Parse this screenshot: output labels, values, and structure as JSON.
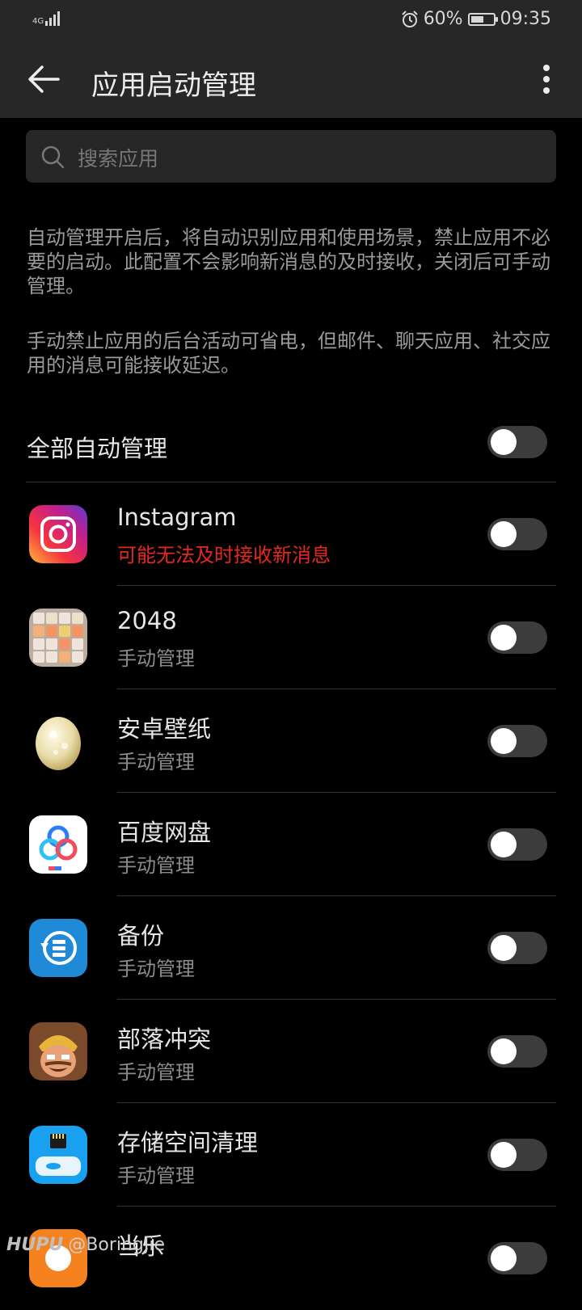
{
  "status_bar": {
    "network": "4G",
    "battery": "60%",
    "battery_level": 0.6,
    "time": "09:35"
  },
  "app_bar": {
    "title": "应用启动管理"
  },
  "search": {
    "placeholder": "搜索应用"
  },
  "descriptions": [
    "自动管理开启后，将自动识别应用和使用场景，禁止应用不必要的启动。此配置不会影响新消息的及时接收，关闭后可手动管理。",
    "手动禁止应用的后台活动可省电，但邮件、聊天应用、社交应用的消息可能接收延迟。"
  ],
  "all_auto": {
    "label": "全部自动管理",
    "enabled": false
  },
  "apps": [
    {
      "name": "Instagram",
      "status": "可能无法及时接收新消息",
      "warn": true,
      "icon": "instagram-icon",
      "enabled": false
    },
    {
      "name": "2048",
      "status": "手动管理",
      "warn": false,
      "icon": "2048-icon",
      "enabled": false
    },
    {
      "name": "安卓壁纸",
      "status": "手动管理",
      "warn": false,
      "icon": "egg-icon",
      "enabled": false
    },
    {
      "name": "百度网盘",
      "status": "手动管理",
      "warn": false,
      "icon": "baidu-netdisk-icon",
      "enabled": false
    },
    {
      "name": "备份",
      "status": "手动管理",
      "warn": false,
      "icon": "backup-icon",
      "enabled": false
    },
    {
      "name": "部落冲突",
      "status": "手动管理",
      "warn": false,
      "icon": "clash-of-clans-icon",
      "enabled": false
    },
    {
      "name": "存储空间清理",
      "status": "手动管理",
      "warn": false,
      "icon": "storage-cleaner-icon",
      "enabled": false
    },
    {
      "name": "当乐",
      "status": "",
      "warn": false,
      "icon": "dangle-icon",
      "enabled": false
    }
  ],
  "watermark": {
    "brand": "HUPU",
    "user": "@BoringJie"
  },
  "colors": {
    "background": "#000000",
    "bar": "#272727",
    "warning": "#e8271f",
    "toggle_off": "#3c3c3c"
  }
}
